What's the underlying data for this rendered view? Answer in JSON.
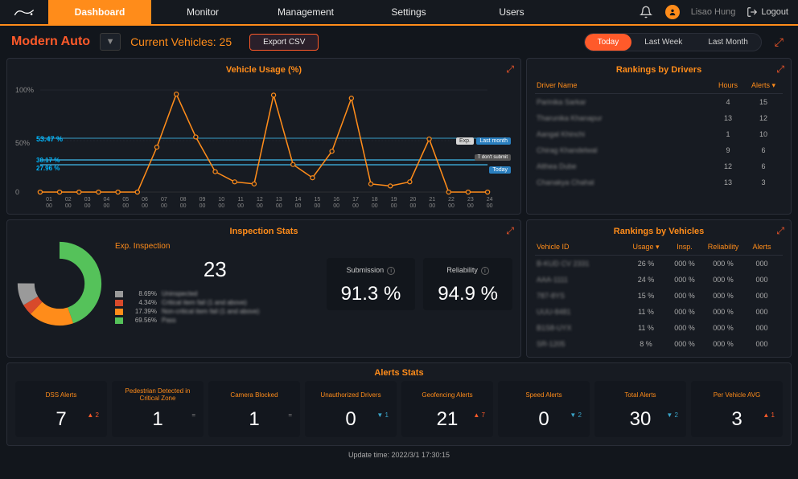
{
  "nav": {
    "items": [
      "Dashboard",
      "Monitor",
      "Management",
      "Settings",
      "Users"
    ],
    "active": 0
  },
  "user": {
    "name": "Lisao Hung",
    "logout": "Logout"
  },
  "sub": {
    "company": "Modern Auto",
    "current_vehicles": "Current Vehicles: 25",
    "export": "Export CSV"
  },
  "range": {
    "items": [
      "Today",
      "Last Week",
      "Last Month"
    ],
    "active": 0
  },
  "usage": {
    "title": "Vehicle Usage (%)",
    "yticks": [
      "100%",
      "50%",
      "0"
    ],
    "pct1": "53.47 %",
    "pct2": "30.17 %",
    "pct3": "27.96 %",
    "chips": {
      "exp": "Exp.",
      "lastmonth": "Last month",
      "dont": "T don't submit",
      "today": "Today"
    }
  },
  "drivers": {
    "title": "Rankings by Drivers",
    "head": {
      "name": "Driver Name",
      "hours": "Hours",
      "alerts": "Alerts ▾"
    },
    "rows": [
      {
        "name": "Parinika Sarkar",
        "hours": "4",
        "alerts": "15"
      },
      {
        "name": "Tharunika Khanapur",
        "hours": "13",
        "alerts": "12"
      },
      {
        "name": "Aangal Khinchi",
        "hours": "1",
        "alerts": "10"
      },
      {
        "name": "Chirag Khandelwal",
        "hours": "9",
        "alerts": "6"
      },
      {
        "name": "Althea Dube",
        "hours": "12",
        "alerts": "6"
      },
      {
        "name": "Chanakya Chahal",
        "hours": "13",
        "alerts": "3"
      }
    ]
  },
  "inspection": {
    "title": "Inspection Stats",
    "exp_title": "Exp. Inspection",
    "exp_value": "23",
    "legend": [
      {
        "color": "#9a9a9a",
        "pct": "8.69%",
        "label": "Uninspected"
      },
      {
        "color": "#d84a2b",
        "pct": "4.34%",
        "label": "Critical item fail (1 and above)"
      },
      {
        "color": "#ff8c1a",
        "pct": "17.39%",
        "label": "Non-critical item fail (1 and above)"
      },
      {
        "color": "#55c25a",
        "pct": "69.56%",
        "label": "Pass"
      }
    ],
    "cards": [
      {
        "title": "Submission",
        "value": "91.3 %"
      },
      {
        "title": "Reliability",
        "value": "94.9 %"
      }
    ]
  },
  "vehicles": {
    "title": "Rankings by Vehicles",
    "head": {
      "id": "Vehicle ID",
      "usage": "Usage ▾",
      "insp": "Insp.",
      "rel": "Reliability",
      "alerts": "Alerts"
    },
    "rows": [
      {
        "id": "B-KUD CV 2331",
        "usage": "26 %",
        "insp": "000 %",
        "rel": "000 %",
        "alerts": "000"
      },
      {
        "id": "AAA-1111",
        "usage": "24 %",
        "insp": "000 %",
        "rel": "000 %",
        "alerts": "000"
      },
      {
        "id": "787-8YS",
        "usage": "15 %",
        "insp": "000 %",
        "rel": "000 %",
        "alerts": "000"
      },
      {
        "id": "UUU-8481",
        "usage": "11 %",
        "insp": "000 %",
        "rel": "000 %",
        "alerts": "000"
      },
      {
        "id": "B1S8-UYX",
        "usage": "11 %",
        "insp": "000 %",
        "rel": "000 %",
        "alerts": "000"
      },
      {
        "id": "SR-1205",
        "usage": "8 %",
        "insp": "000 %",
        "rel": "000 %",
        "alerts": "000"
      }
    ]
  },
  "alerts": {
    "title": "Alerts Stats",
    "cards": [
      {
        "title": "DSS Alerts",
        "value": "7",
        "delta": "▲ 2",
        "dir": "up"
      },
      {
        "title": "Pedestrian Detected in Critical Zone",
        "value": "1",
        "delta": "=",
        "dir": "eq"
      },
      {
        "title": "Camera Blocked",
        "value": "1",
        "delta": "=",
        "dir": "eq"
      },
      {
        "title": "Unauthorized Drivers",
        "value": "0",
        "delta": "▼ 1",
        "dir": "down"
      },
      {
        "title": "Geofencing Alerts",
        "value": "21",
        "delta": "▲ 7",
        "dir": "up"
      },
      {
        "title": "Speed Alerts",
        "value": "0",
        "delta": "▼ 2",
        "dir": "down"
      },
      {
        "title": "Total Alerts",
        "value": "30",
        "delta": "▼ 2",
        "dir": "down"
      },
      {
        "title": "Per Vehicle AVG",
        "value": "3",
        "delta": "▲ 1",
        "dir": "up"
      }
    ]
  },
  "footer": "Update time: 2022/3/1 17:30:15",
  "chart_data": {
    "type": "line",
    "title": "Vehicle Usage (%)",
    "ylabel": "%",
    "ylim": [
      0,
      100
    ],
    "x": [
      1,
      2,
      3,
      4,
      5,
      6,
      7,
      8,
      9,
      10,
      11,
      12,
      13,
      14,
      15,
      16,
      17,
      18,
      19,
      20,
      21,
      22,
      23,
      24
    ],
    "series": [
      {
        "name": "Usage",
        "values": [
          0,
          0,
          0,
          0,
          0,
          0,
          44,
          96,
          54,
          20,
          10,
          8,
          95,
          27,
          14,
          40,
          92,
          8,
          6,
          10,
          52,
          0,
          0,
          0
        ]
      }
    ],
    "reference_lines": [
      {
        "label": "Exp.",
        "value": 53.47
      },
      {
        "label": "Last month",
        "value": 53.47
      },
      {
        "label": "T don't submit",
        "value": 30.17
      },
      {
        "label": "Today",
        "value": 27.96
      }
    ]
  }
}
